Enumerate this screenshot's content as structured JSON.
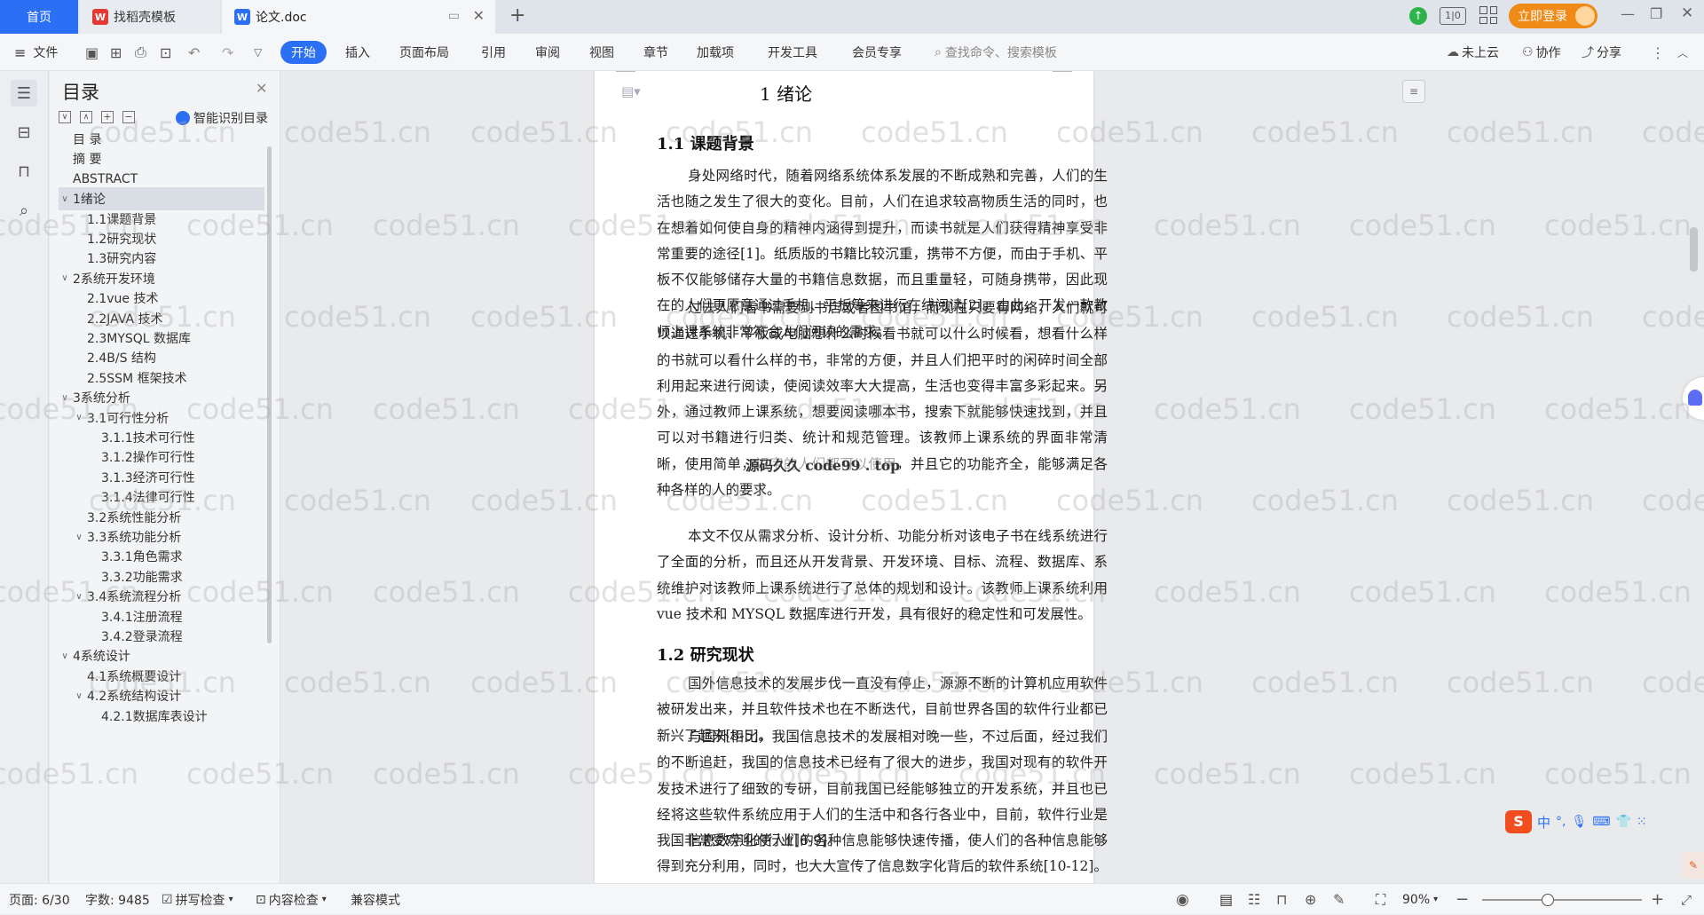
{
  "tabs": {
    "home": "首页",
    "template": "找稻壳模板",
    "doc": "论文.doc",
    "login": "立即登录"
  },
  "menu": {
    "file": "文件",
    "start": "开始",
    "insert": "插入",
    "layout": "页面布局",
    "ref": "引用",
    "review": "审阅",
    "view": "视图",
    "chapter": "章节",
    "addons": "加载项",
    "dev": "开发工具",
    "vip": "会员专享",
    "search": "查找命令、搜索模板",
    "cloud": "未上云",
    "collab": "协作",
    "share": "分享"
  },
  "toc": {
    "title": "目录",
    "smart": "智能识别目录",
    "items": [
      {
        "label": "目  录",
        "level": 0,
        "caret": ""
      },
      {
        "label": "摘    要",
        "level": 0,
        "caret": ""
      },
      {
        "label": "ABSTRACT",
        "level": 0,
        "caret": ""
      },
      {
        "label": "1绪论",
        "level": 0,
        "caret": "down",
        "selected": true
      },
      {
        "label": "1.1课题背景",
        "level": 1,
        "caret": ""
      },
      {
        "label": "1.2研究现状",
        "level": 1,
        "caret": ""
      },
      {
        "label": "1.3研究内容",
        "level": 1,
        "caret": ""
      },
      {
        "label": "2系统开发环境",
        "level": 0,
        "caret": "down"
      },
      {
        "label": "2.1vue 技术",
        "level": 1,
        "caret": ""
      },
      {
        "label": "2.2JAVA 技术",
        "level": 1,
        "caret": ""
      },
      {
        "label": "2.3MYSQL 数据库",
        "level": 1,
        "caret": ""
      },
      {
        "label": "2.4B/S 结构",
        "level": 1,
        "caret": ""
      },
      {
        "label": "2.5SSM 框架技术",
        "level": 1,
        "caret": ""
      },
      {
        "label": "3系统分析",
        "level": 0,
        "caret": "down"
      },
      {
        "label": "3.1可行性分析",
        "level": 1,
        "caret": "down"
      },
      {
        "label": "3.1.1技术可行性",
        "level": 2,
        "caret": ""
      },
      {
        "label": "3.1.2操作可行性",
        "level": 2,
        "caret": ""
      },
      {
        "label": "3.1.3经济可行性",
        "level": 2,
        "caret": ""
      },
      {
        "label": "3.1.4法律可行性",
        "level": 2,
        "caret": ""
      },
      {
        "label": "3.2系统性能分析",
        "level": 1,
        "caret": ""
      },
      {
        "label": "3.3系统功能分析",
        "level": 1,
        "caret": "down"
      },
      {
        "label": "3.3.1角色需求",
        "level": 2,
        "caret": ""
      },
      {
        "label": "3.3.2功能需求",
        "level": 2,
        "caret": ""
      },
      {
        "label": "3.4系统流程分析",
        "level": 1,
        "caret": "down"
      },
      {
        "label": "3.4.1注册流程",
        "level": 2,
        "caret": ""
      },
      {
        "label": "3.4.2登录流程",
        "level": 2,
        "caret": ""
      },
      {
        "label": "4系统设计",
        "level": 0,
        "caret": "down"
      },
      {
        "label": "4.1系统概要设计",
        "level": 1,
        "caret": ""
      },
      {
        "label": "4.2系统结构设计",
        "level": 1,
        "caret": "down"
      },
      {
        "label": "4.2.1数据库表设计",
        "level": 2,
        "caret": ""
      }
    ]
  },
  "doc": {
    "chapter_title": "1  绪论",
    "h11": "1.1  课题背景",
    "p1": "身处网络时代，随着网络系统体系发展的不断成熟和完善，人们的生活也随之发生了很大的变化。目前，人们在追求较高物质生活的同时，也在想着如何使自身的精神内涵得到提升，而读书就是人们获得精神享受非常重要的途径[1]。纸质版的书籍比较沉重，携带不方便，而由于手机、平板不仅能够储存大量的书籍信息数据，而且重量轻，可随身携带，因此现在的人们更愿意通过手机、平板等来进行在线阅读[2]。由此，开发一款教师上课系统非常符合人们阅读的需求。",
    "p2": "过去人们看书需要到书店或者图书馆，而现在只要有网络，人们就可以通过手机、平板或电脑想什么时候看书就可以什么时候看，想看什么样的书就可以看什么样的书，非常的方便，并且人们把平时的闲碎时间全部利用起来进行阅读，使阅读效率大大提高，生活也变得丰富多彩起来。另外，通过教师上课系统，想要阅读哪本书，搜索下就能够快速找到，并且可以对书籍进行归类、统计和规范管理。该教师上课系统的界面非常清晰，使用简单，识字的人们都可以使用，并且它的功能齐全，能够满足各种各样的人的要求。",
    "overlay": "源码久久 code99 . top",
    "p3": "本文不仅从需求分析、设计分析、功能分析对该电子书在线系统进行了全面的分析，而且还从开发背景、开发环境、目标、流程、数据库、系统维护对该教师上课系统进行了总体的规划和设计。该教师上课系统利用 vue 技术和 MYSQL 数据库进行开发，具有很好的稳定性和可发展性。",
    "h12": "1.2  研究现状",
    "p4": "国外信息技术的发展步伐一直没有停止，源源不断的计算机应用软件被研发出来，并且软件技术也在不断迭代，目前世界各国的软件行业都已新兴了起来[3-5]。",
    "p5": "与国外相比，我国信息技术的发展相对晚一些，不过后面，经过我们的不断追赶，我国的信息技术已经有了很大的进步，我国对现有的软件开发技术进行了细致的专研，目前我国已经能够独立的开发系统，并且也已经将这些软件系统应用于人们的生活中和各行各业中，目前，软件行业是我国非常受欢迎的行业[6-9]。",
    "p6": "信息数字化使人们的各种信息能够快速传播，使人们的各种信息能够得到充分利用，同时，也大大宣传了信息数字化背后的软件系统[10-12]。软件开发团队的能力越来越"
  },
  "status": {
    "page": "页面: 6/30",
    "words": "字数: 9485",
    "spell": "拼写检查",
    "content": "内容检查",
    "compat": "兼容模式",
    "zoom": "90%"
  },
  "ime": {
    "lang": "中"
  },
  "watermark": "code51.cn"
}
